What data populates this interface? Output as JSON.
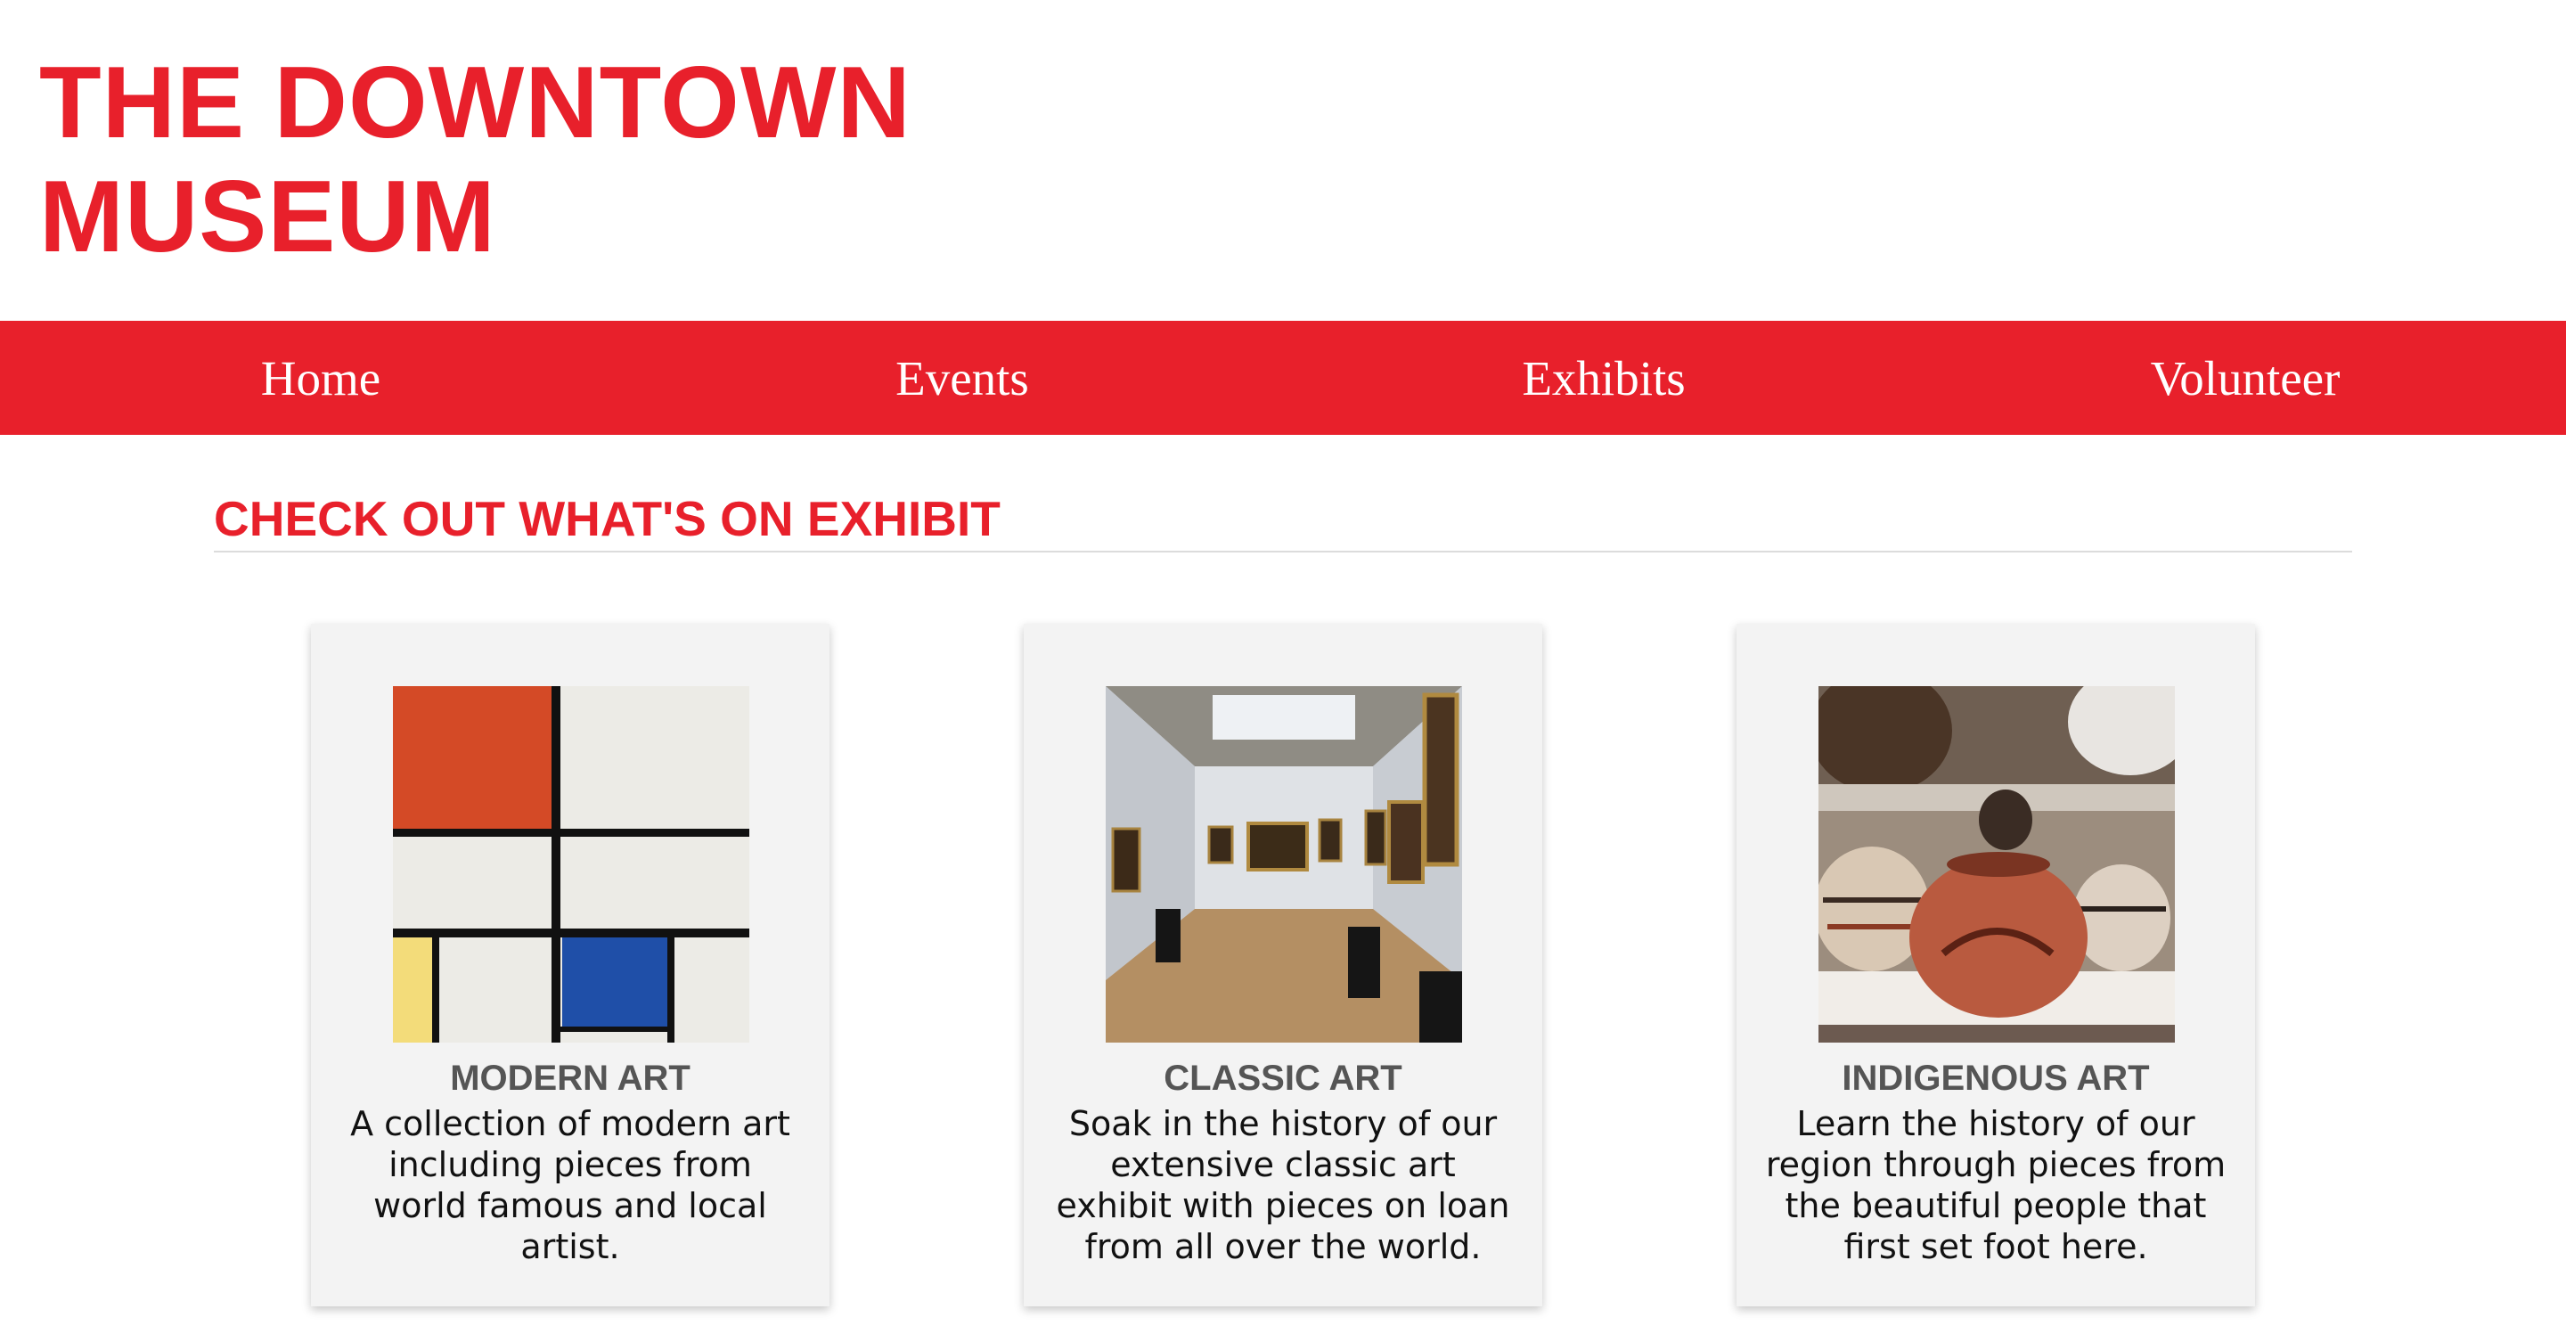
{
  "header": {
    "title_line1": "THE DOWNTOWN",
    "title_line2": "MUSEUM"
  },
  "nav": {
    "items": [
      "Home",
      "Events",
      "Exhibits",
      "Volunteer"
    ]
  },
  "main": {
    "heading": "CHECK OUT WHAT'S ON EXHIBIT",
    "cards": [
      {
        "title": "MODERN ART",
        "description": "A collection of modern art including pieces from world famous and local artist.",
        "image": "mondrian-painting"
      },
      {
        "title": "CLASSIC ART",
        "description": "Soak in the history of our extensive classic art exhibit with pieces on loan from all over the world.",
        "image": "gallery-hall-photo"
      },
      {
        "title": "INDIGENOUS ART",
        "description": "Learn the history of our region through pieces from the beautiful people that first set foot here.",
        "image": "pottery-photo"
      }
    ]
  },
  "colors": {
    "brand_red": "#e8202b",
    "card_bg": "#f3f3f3",
    "mondrian_red": "#d44a26",
    "mondrian_blue": "#1f4fa8",
    "mondrian_yellow": "#f3dc7a"
  }
}
